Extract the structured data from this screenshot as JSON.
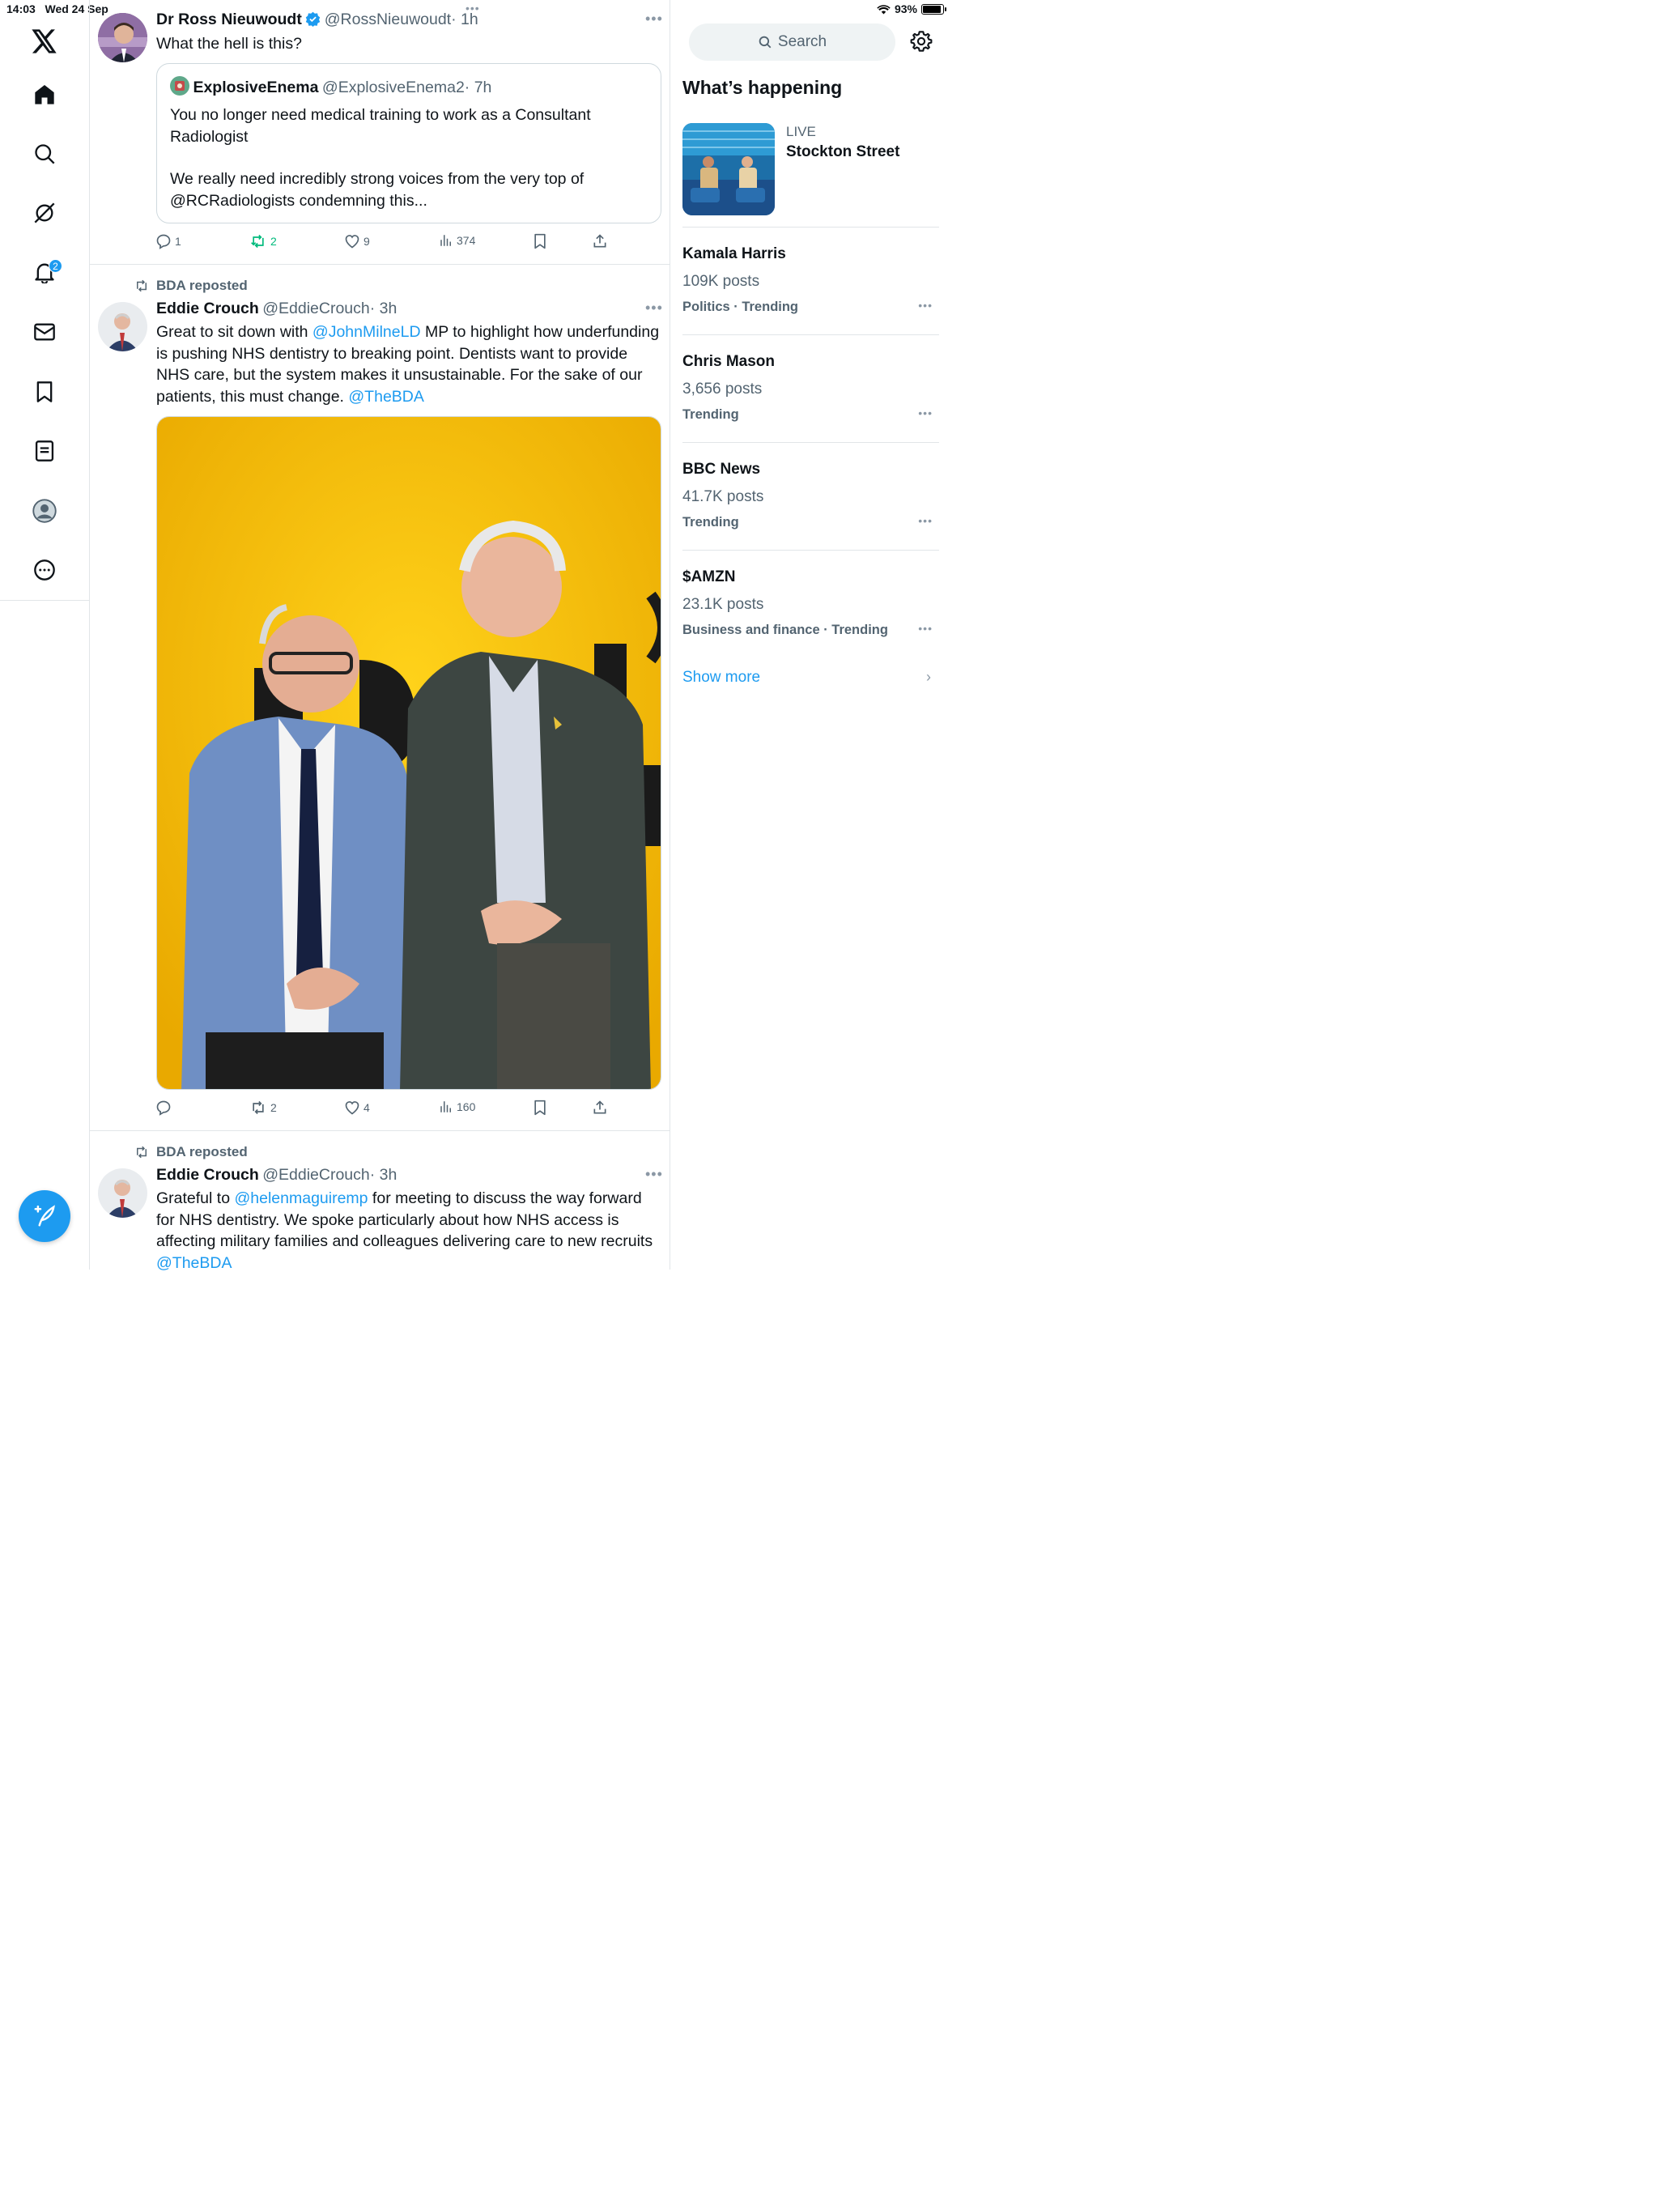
{
  "status_bar": {
    "time": "14:03",
    "date": "Wed 24 Sep",
    "battery": "93%",
    "battery_level": 0.93
  },
  "nav": {
    "notifications_badge": "2",
    "items": [
      "x-logo",
      "home",
      "explore",
      "grok",
      "notifications",
      "messages",
      "bookmarks",
      "lists",
      "profile",
      "more"
    ]
  },
  "tweet1": {
    "name": "Dr Ross Nieuwoudt",
    "handle": "@RossNieuwoudt",
    "time": "· 1h",
    "text": "What the hell is this?",
    "quote": {
      "name": "ExplosiveEnema",
      "handle": "@ExplosiveEnema2",
      "time": "· 7h",
      "text1": "You no longer need medical training to work as a Consultant Radiologist",
      "text2": "We really need incredibly strong voices from the very top of @RCRadiologists condemning this..."
    },
    "replies": "1",
    "reposts": "2",
    "likes": "9",
    "views": "374"
  },
  "tweet2": {
    "repost_by": "BDA reposted",
    "name": "Eddie Crouch",
    "handle": "@EddieCrouch",
    "time": "· 3h",
    "text_a": "Great to sit down with ",
    "mention_a": "@JohnMilneLD",
    "text_b": " MP to highlight how underfunding is pushing NHS dentistry to breaking point. Dentists want to provide NHS care, but the system makes it unsustainable. For the sake of our patients, this must change. ",
    "mention_b": "@TheBDA",
    "replies": "",
    "reposts": "2",
    "likes": "4",
    "views": "160"
  },
  "tweet3": {
    "repost_by": "BDA reposted",
    "name": "Eddie Crouch",
    "handle": "@EddieCrouch",
    "time": "· 3h",
    "text_a": "Grateful to ",
    "mention_a": "@helenmaguiremp",
    "text_b": " for meeting to discuss the way forward for NHS dentistry. We spoke particularly about how NHS access is affecting military families and colleagues delivering care to new recruits ",
    "mention_b": "@TheBDA"
  },
  "sidebar": {
    "search_placeholder": "Search",
    "section_title": "What’s happening",
    "live": {
      "label": "LIVE",
      "title": "Stockton Street"
    },
    "trends": [
      {
        "name": "Kamala Harris",
        "posts": "109K posts",
        "meta": "Politics · Trending"
      },
      {
        "name": "Chris Mason",
        "posts": "3,656 posts",
        "meta": "Trending"
      },
      {
        "name": "BBC News",
        "posts": "41.7K posts",
        "meta": "Trending"
      },
      {
        "name": "$AMZN",
        "posts": "23.1K posts",
        "meta": "Business and finance · Trending"
      }
    ],
    "show_more": "Show more"
  },
  "colors": {
    "accent": "#1d9bf0",
    "repost_green": "#00ba7c",
    "secondary": "#536471",
    "photo_bg": "#f5c010"
  }
}
